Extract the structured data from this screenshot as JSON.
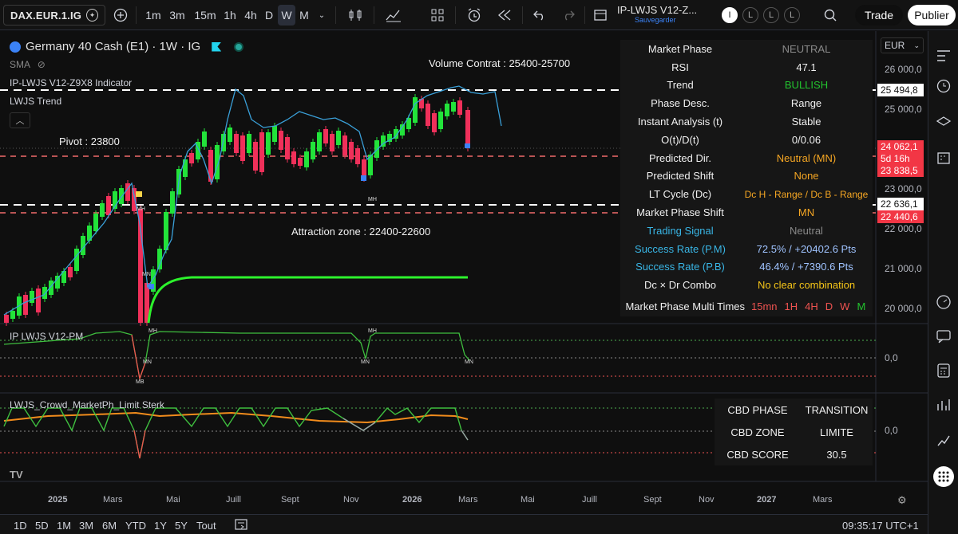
{
  "toolbar": {
    "symbol": "DAX.EUR.1.IG",
    "intervals": [
      "1m",
      "3m",
      "15m",
      "1h",
      "4h",
      "D",
      "W",
      "M"
    ],
    "active_interval": "W",
    "indicator_name": "IP-LWJS V12-Z...",
    "save_label": "Sauvegarder",
    "layout_circles": [
      "I",
      "L",
      "L",
      "L"
    ],
    "trade_label": "Trade",
    "publish_label": "Publier"
  },
  "legend": {
    "title": "Germany 40 Cash (E1) · 1W · IG",
    "sma": "SMA",
    "indicator1": "IP-LWJS V12-Z9X8 Indicator",
    "indicator2": "LWJS Trend",
    "pane2_title": "IP LWJS V12-PM",
    "pane3_title": "LWJS_Crowd_MarketPh_Limit Sterk"
  },
  "annotations": {
    "volume_contract": "Volume Contrat : 25400-25700",
    "pivot": "Pivot : 23800",
    "attraction_zone": "Attraction zone : 22400-22600"
  },
  "info_table": [
    {
      "label": "Market Phase",
      "value": "NEUTRAL",
      "color": "#8a8a8a"
    },
    {
      "label": "RSI",
      "value": "47.1",
      "color": "#f0f0f0"
    },
    {
      "label": "Trend",
      "value": "BULLISH",
      "color": "#22c32e"
    },
    {
      "label": "Phase Desc.",
      "value": "Range",
      "color": "#f0f0f0"
    },
    {
      "label": "Instant Analysis (t)",
      "value": "Stable",
      "color": "#f0f0f0"
    },
    {
      "label": "O(t)/D(t)",
      "value": "0/0.06",
      "color": "#f0f0f0"
    },
    {
      "label": "Predicted Dir.",
      "value": "Neutral (MN)",
      "color": "#f5a623"
    },
    {
      "label": "Predicted Shift",
      "value": "None",
      "color": "#f5a623"
    },
    {
      "label": "LT Cycle (Dc)",
      "value": "Dc H - Range / Dc B - Range",
      "color": "#f5a623"
    },
    {
      "label": "Market Phase Shift",
      "value": "MN",
      "color": "#f5a623"
    },
    {
      "label": "Trading Signal",
      "value": "Neutral",
      "color": "#8a8a8a",
      "label_color": "#39b6e6"
    },
    {
      "label": "Success Rate (P.M)",
      "value": "72.5% / +20402.6 Pts",
      "color": "#9fc3ff",
      "label_color": "#39b6e6"
    },
    {
      "label": "Success Rate (P.B)",
      "value": "46.4% / +7390.6 Pts",
      "color": "#9fc3ff",
      "label_color": "#39b6e6"
    },
    {
      "label": "Dc × Dr Combo",
      "value": "No clear combination",
      "color": "#f5c518"
    }
  ],
  "multi_times": {
    "label": "Market Phase Multi Times",
    "items": [
      {
        "t": "15mn",
        "color": "#ef5350"
      },
      {
        "t": "1H",
        "color": "#ef5350"
      },
      {
        "t": "4H",
        "color": "#ef5350"
      },
      {
        "t": "D",
        "color": "#ef5350"
      },
      {
        "t": "W",
        "color": "#ef5350"
      },
      {
        "t": "M",
        "color": "#22c32e"
      }
    ]
  },
  "cbd_table": [
    {
      "label": "CBD PHASE",
      "value": "TRANSITION"
    },
    {
      "label": "CBD ZONE",
      "value": "LIMITE"
    },
    {
      "label": "CBD SCORE",
      "value": "30.5"
    }
  ],
  "price_axis": {
    "currency": "EUR",
    "ticks": [
      "26 000,0",
      "25 000,0",
      "23 000,0",
      "22 000,0",
      "21 000,0",
      "20 000,0"
    ],
    "tags": [
      {
        "text": "25 494,8",
        "bg": "#ffffff",
        "fg": "#111111"
      },
      {
        "text": "24 062,1",
        "bg": "#f23645",
        "fg": "#ffffff"
      },
      {
        "text": "5d 16h",
        "bg": "#f23645",
        "fg": "#ffffff"
      },
      {
        "text": "23 838,5",
        "bg": "#f23645",
        "fg": "#ffffff"
      },
      {
        "text": "22 636,1",
        "bg": "#ffffff",
        "fg": "#111111"
      },
      {
        "text": "22 440,6",
        "bg": "#f23645",
        "fg": "#ffffff"
      }
    ],
    "pane2_zero": "0,0",
    "pane3_zero": "0,0"
  },
  "time_axis": [
    "2025",
    "Mars",
    "Mai",
    "Juill",
    "Sept",
    "Nov",
    "2026",
    "Mars",
    "Mai",
    "Juill",
    "Sept",
    "Nov",
    "2027",
    "Mars"
  ],
  "bottom_bar": {
    "ranges": [
      "1D",
      "5D",
      "1M",
      "3M",
      "6M",
      "YTD",
      "1Y",
      "5Y",
      "Tout"
    ],
    "clock": "09:35:17 UTC+1"
  },
  "markers": {
    "mh": "MH",
    "mn": "MN",
    "mb": "MB"
  },
  "colors": {
    "up": "#22e33a",
    "down": "#f0305a",
    "blue_line": "#3aa0d9",
    "green_line": "#2cf22c",
    "orange_line": "#f28c1c"
  }
}
